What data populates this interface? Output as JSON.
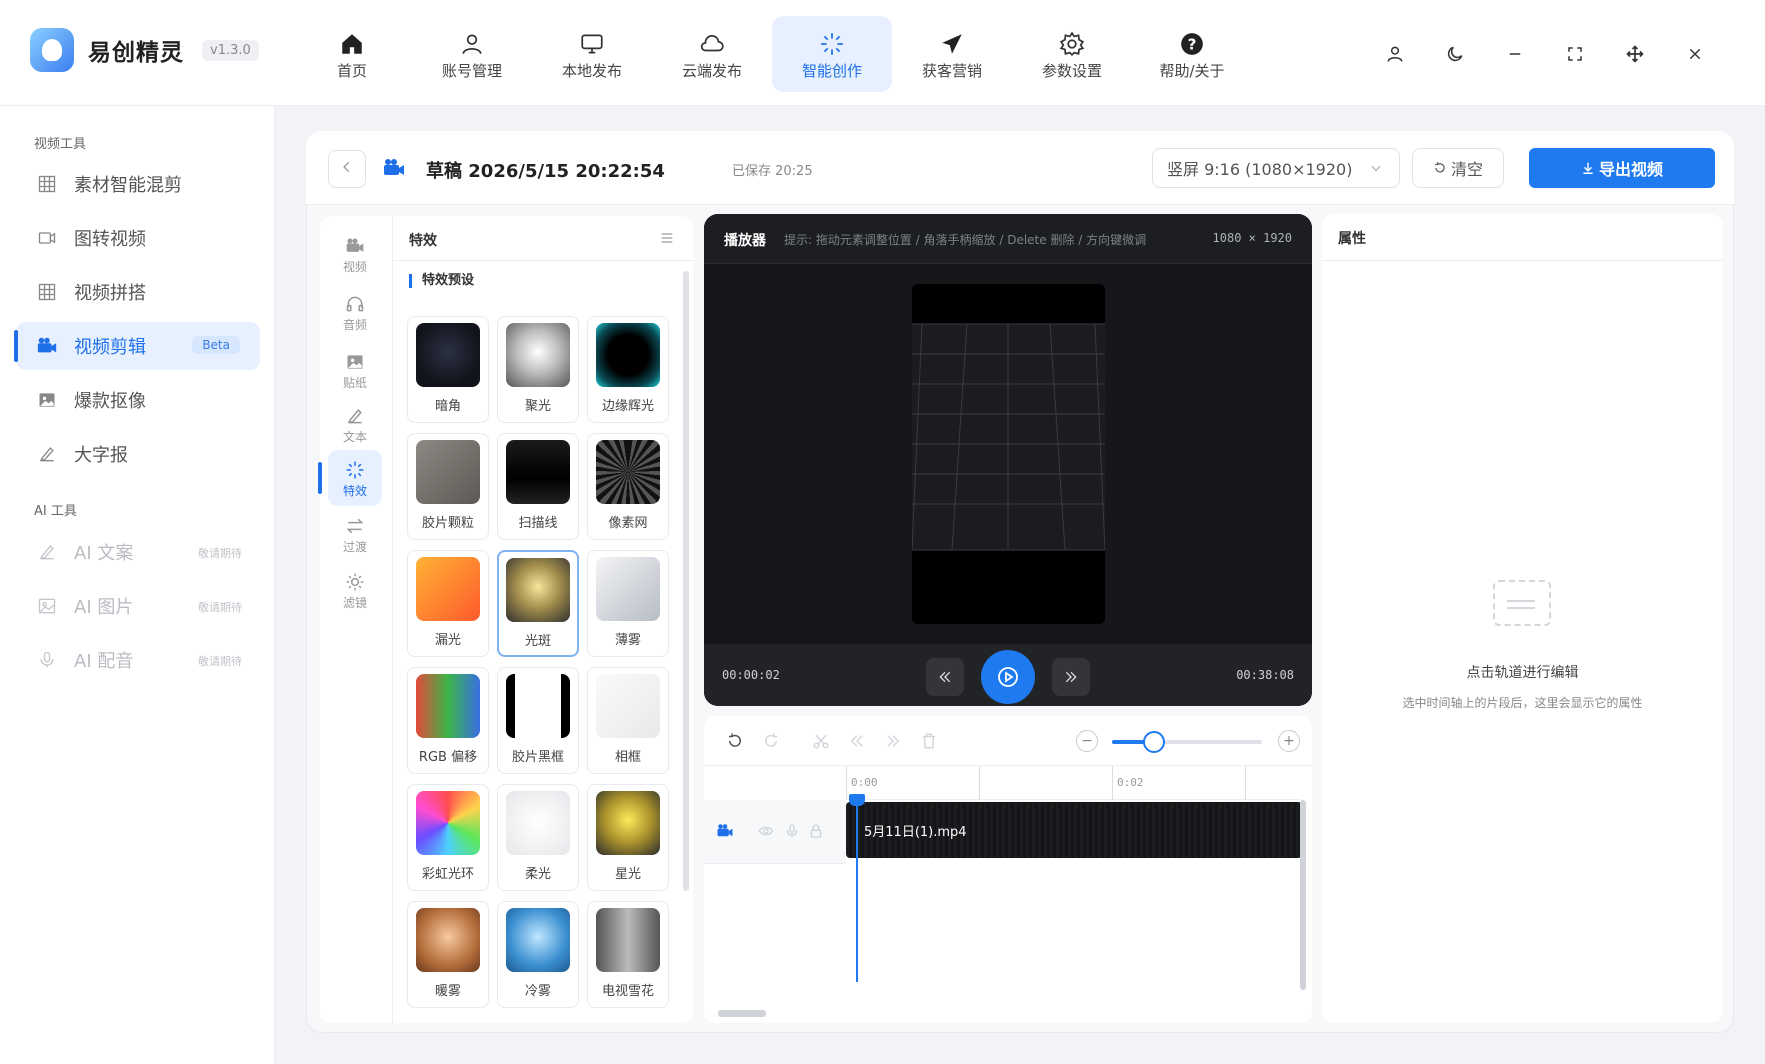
{
  "app": {
    "name": "易创精灵",
    "version": "v1.3.0"
  },
  "nav": [
    {
      "label": "首页",
      "icon": "home-icon"
    },
    {
      "label": "账号管理",
      "icon": "user-icon"
    },
    {
      "label": "本地发布",
      "icon": "monitor-icon"
    },
    {
      "label": "云端发布",
      "icon": "cloud-icon"
    },
    {
      "label": "智能创作",
      "icon": "sparkle-icon",
      "active": true
    },
    {
      "label": "获客营销",
      "icon": "send-icon"
    },
    {
      "label": "参数设置",
      "icon": "gear-icon"
    },
    {
      "label": "帮助/关于",
      "icon": "help-icon"
    }
  ],
  "sidebar": {
    "video_tools_title": "视频工具",
    "video_tools": [
      {
        "label": "素材智能混剪",
        "icon": "grid-icon"
      },
      {
        "label": "图转视频",
        "icon": "video-icon"
      },
      {
        "label": "视频拼搭",
        "icon": "grid-icon"
      },
      {
        "label": "视频剪辑",
        "icon": "camera-icon",
        "active": true,
        "badge": "Beta"
      },
      {
        "label": "爆款抠像",
        "icon": "image-icon"
      },
      {
        "label": "大字报",
        "icon": "pen-icon"
      }
    ],
    "ai_tools_title": "AI 工具",
    "ai_tools": [
      {
        "label": "AI 文案",
        "icon": "pen-icon",
        "note": "敬请期待"
      },
      {
        "label": "AI 图片",
        "icon": "image-icon",
        "note": "敬请期待"
      },
      {
        "label": "AI 配音",
        "icon": "mic-icon",
        "note": "敬请期待"
      }
    ]
  },
  "editor": {
    "draft_title": "草稿 2026/5/15 20:22:54",
    "saved": "已保存 20:25",
    "ratio": "竖屏 9:16 (1080×1920)",
    "clear_label": "清空",
    "export_label": "导出视频"
  },
  "rail": [
    {
      "label": "视频",
      "icon": "video-icon"
    },
    {
      "label": "音频",
      "icon": "headphone-icon"
    },
    {
      "label": "贴纸",
      "icon": "image-icon"
    },
    {
      "label": "文本",
      "icon": "pen-icon"
    },
    {
      "label": "特效",
      "icon": "sparkle-icon",
      "active": true
    },
    {
      "label": "过渡",
      "icon": "transition-icon"
    },
    {
      "label": "滤镜",
      "icon": "sun-icon"
    }
  ],
  "effects": {
    "title": "特效",
    "subtitle": "特效预设",
    "items": [
      {
        "label": "暗角",
        "thumb": "radial-gradient(circle at 50% 45%, #2b3042 0%, #12141c 70%)"
      },
      {
        "label": "聚光",
        "thumb": "radial-gradient(circle at 50% 45%, #ffffff 0%, #bcbcbc 45%, #555 100%)"
      },
      {
        "label": "边缘辉光",
        "thumb": "radial-gradient(circle, #000 45%, #0a4b55 75%, #1bd1d6 100%)"
      },
      {
        "label": "胶片颗粒",
        "thumb": "linear-gradient(135deg, #8d8883, #5e5954)"
      },
      {
        "label": "扫描线",
        "thumb": "linear-gradient(180deg, #1a1a1a, #000 60%, #222)"
      },
      {
        "label": "像素网",
        "thumb": "repeating-conic-gradient(#111 0deg 8deg, #555 8deg 16deg)"
      },
      {
        "label": "漏光",
        "thumb": "linear-gradient(135deg, #ffb234, #ff5a2c)"
      },
      {
        "label": "光斑",
        "thumb": "radial-gradient(circle at 50% 45%, #f6e59a 0%, #a48f4d 45%, #2e2e2e 100%)",
        "selected": true
      },
      {
        "label": "薄雾",
        "thumb": "linear-gradient(135deg, #f3f4f6, #b7bcc4)"
      },
      {
        "label": "RGB 偏移",
        "thumb": "linear-gradient(90deg, #e24a3a, #3cb54a 50%, #3a6ee2)"
      },
      {
        "label": "胶片黑框",
        "thumb": "linear-gradient(90deg, #000 0 14%, #fff 14% 86%, #000 86%)"
      },
      {
        "label": "相框",
        "thumb": "linear-gradient(135deg, #fafafa, #e8e9eb)"
      },
      {
        "label": "彩虹光环",
        "thumb": "conic-gradient(#ff4d4d, #ffd24d, #5ce65c, #4dd2ff, #6b4dff, #ff4dd2, #ff4d4d)"
      },
      {
        "label": "柔光",
        "thumb": "radial-gradient(circle, #ffffff, #e6e7ea)"
      },
      {
        "label": "星光",
        "thumb": "radial-gradient(circle at 50% 45%, #ffe95a 0%, #a8902c 50%, #2a2a2a 100%)"
      },
      {
        "label": "暖雾",
        "thumb": "radial-gradient(circle at 50% 45%, #f6caa0 0%, #b56d3b 60%, #6b3a1e 100%)"
      },
      {
        "label": "冷雾",
        "thumb": "radial-gradient(circle at 50% 45%, #bfe6ff 0%, #3b8fd0 60%, #1e5a8f 100%)"
      },
      {
        "label": "电视雪花",
        "thumb": "linear-gradient(90deg, #555, #bbb 50%, #555)"
      }
    ]
  },
  "player": {
    "title": "播放器",
    "hint": "提示: 拖动元素调整位置 / 角落手柄缩放 / Delete 删除 / 方向键微调",
    "resolution": "1080 × 1920",
    "current_time": "00:00:02",
    "total_time": "00:38:08"
  },
  "timeline": {
    "ticks": [
      "0:00",
      "0:02"
    ],
    "clip_name": "5月11日(1).mp4",
    "zoom_level": 0.28
  },
  "properties": {
    "title": "属性",
    "empty_title": "点击轨道进行编辑",
    "empty_sub": "选中时间轴上的片段后，这里会显示它的属性"
  }
}
